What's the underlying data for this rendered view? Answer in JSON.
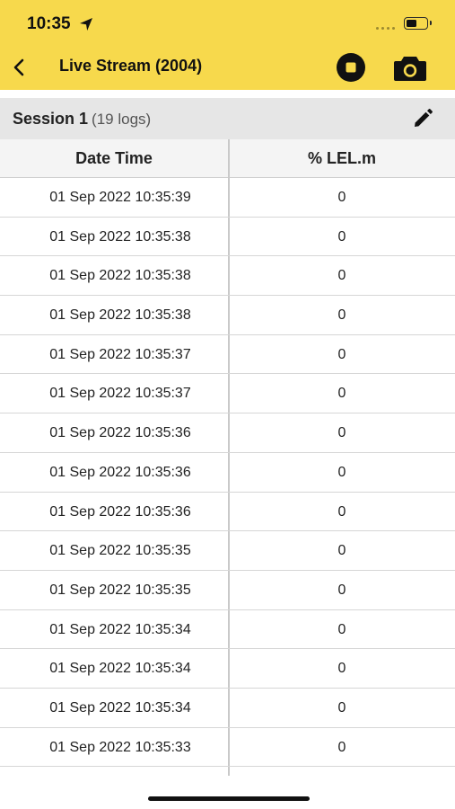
{
  "status_bar": {
    "time": "10:35",
    "battery_level": 0.55
  },
  "nav": {
    "title": "Live Stream (2004)",
    "icons": [
      "chevron-left-icon",
      "stop-icon",
      "camera-icon"
    ]
  },
  "session": {
    "title": "Session 1",
    "count_label": "(19 logs)",
    "edit_icon": "pencil-icon"
  },
  "table": {
    "headers": [
      "Date Time",
      "% LEL.m"
    ],
    "rows": [
      [
        "01 Sep 2022 10:35:39",
        "0"
      ],
      [
        "01 Sep 2022 10:35:38",
        "0"
      ],
      [
        "01 Sep 2022 10:35:38",
        "0"
      ],
      [
        "01 Sep 2022 10:35:38",
        "0"
      ],
      [
        "01 Sep 2022 10:35:37",
        "0"
      ],
      [
        "01 Sep 2022 10:35:37",
        "0"
      ],
      [
        "01 Sep 2022 10:35:36",
        "0"
      ],
      [
        "01 Sep 2022 10:35:36",
        "0"
      ],
      [
        "01 Sep 2022 10:35:36",
        "0"
      ],
      [
        "01 Sep 2022 10:35:35",
        "0"
      ],
      [
        "01 Sep 2022 10:35:35",
        "0"
      ],
      [
        "01 Sep 2022 10:35:34",
        "0"
      ],
      [
        "01 Sep 2022 10:35:34",
        "0"
      ],
      [
        "01 Sep 2022 10:35:34",
        "0"
      ],
      [
        "01 Sep 2022 10:35:33",
        "0"
      ]
    ]
  },
  "colors": {
    "accent": "#f7d94c",
    "session_bg": "#e6e6e6",
    "header_bg": "#f4f4f4"
  }
}
